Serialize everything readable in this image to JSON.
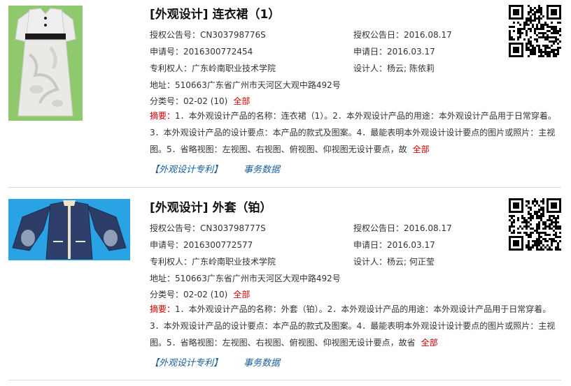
{
  "labels": {
    "auth_no": "授权公告号：",
    "auth_date": "授权公告日：",
    "app_no": "申请号：",
    "app_date": "申请日：",
    "holder": "专利权人：",
    "designer": "设计人：",
    "address": "地址：",
    "class_no": "分类号：",
    "abstract": "摘要：",
    "more": "全部"
  },
  "results": [
    {
      "title": "[外观设计] 连衣裙（1）",
      "auth_no": "CN303798776S",
      "auth_date": "2016.08.17",
      "app_no": "2016300772454",
      "app_date": "2016.03.17",
      "holder": "广东岭南职业技术学院",
      "designer": "杨云; 陈依莉",
      "address": "510663广东省广州市天河区大观中路492号",
      "class_no": "02-02 (10)",
      "abstract": "1．本外观设计产品的名称：连衣裙（1）。2．本外观设计产品的用途：本外观设计产品用于日常穿着。3．本外观设计产品的设计要点：本产品的款式及图案。4．最能表明本外观设计设计要点的图片或照片：主视图。5．省略视图：左视图、右视图、俯视图、仰视图无设计要点，故",
      "tag_patent": "【外观设计专利】",
      "tag_events": "事务数据",
      "image": "dress-photo"
    },
    {
      "title": "[外观设计] 外套（铂）",
      "auth_no": "CN303798777S",
      "auth_date": "2016.08.17",
      "app_no": "2016300772577",
      "app_date": "2016.03.17",
      "holder": "广东岭南职业技术学院",
      "designer": "杨云; 何正莹",
      "address": "510663广东省广州市天河区大观中路492号",
      "class_no": "02-02 (10)",
      "abstract": "1．本外观设计产品的名称：外套（铂）。2．本外观设计产品的用途：本外观设计产品用于日常穿着。3．本外观设计产品的设计要点：本产品的款式及图案。4．最能表明本外观设计设计要点的图片或照片：主视图。5．省略视图：左视图、右视图、俯视图、仰视图无设计要点，故省",
      "tag_patent": "【外观设计专利】",
      "tag_events": "事务数据",
      "image": "jacket-photo"
    }
  ]
}
